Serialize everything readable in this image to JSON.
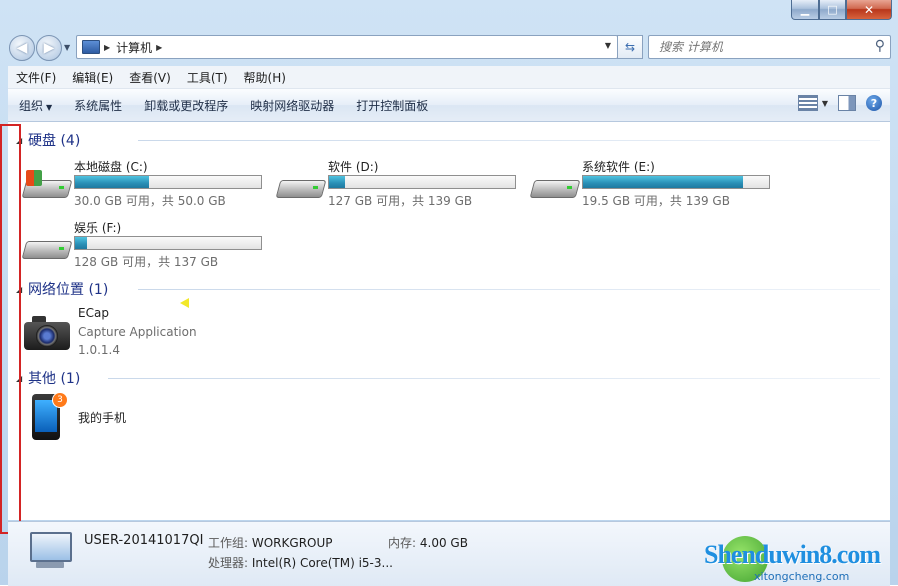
{
  "window": {
    "caption": {
      "minimize": "▁",
      "maximize": "□",
      "close": "✕"
    }
  },
  "address": {
    "path": "计算机",
    "search_placeholder": "搜索 计算机"
  },
  "menu": [
    "文件(F)",
    "编辑(E)",
    "查看(V)",
    "工具(T)",
    "帮助(H)"
  ],
  "commands": {
    "organize": "组织",
    "system_properties": "系统属性",
    "uninstall": "卸载或更改程序",
    "map_drive": "映射网络驱动器",
    "control_panel": "打开控制面板"
  },
  "groups": {
    "hard_disks": "硬盘 (4)",
    "network": "网络位置 (1)",
    "other": "其他 (1)"
  },
  "drives": [
    {
      "name": "本地磁盘 (C:)",
      "info": "30.0 GB 可用，共 50.0 GB",
      "used_fraction": 0.4,
      "icon": "windows-drive-icon"
    },
    {
      "name": "软件 (D:)",
      "info": "127 GB 可用，共 139 GB",
      "used_fraction": 0.086,
      "icon": "drive-icon"
    },
    {
      "name": "系统软件 (E:)",
      "info": "19.5 GB 可用，共 139 GB",
      "used_fraction": 0.86,
      "icon": "drive-icon"
    },
    {
      "name": "娱乐 (F:)",
      "info": "128 GB 可用，共 137 GB",
      "used_fraction": 0.066,
      "icon": "drive-icon"
    }
  ],
  "network_item": {
    "name": "ECap",
    "description": "Capture Application",
    "version": "1.0.1.4",
    "icon": "camera-icon"
  },
  "other_item": {
    "name": "我的手机",
    "badge": "3",
    "icon": "phone-icon"
  },
  "details": {
    "computer_name": "USER-20141017QI",
    "workgroup_label": "工作组:",
    "workgroup": "WORKGROUP",
    "memory_label": "内存:",
    "memory": "4.00 GB",
    "cpu_label": "处理器:",
    "cpu": "Intel(R) Core(TM) i5-3..."
  },
  "watermark": {
    "text": "Shenduwin8.com",
    "sub": "xitongcheng.com"
  }
}
